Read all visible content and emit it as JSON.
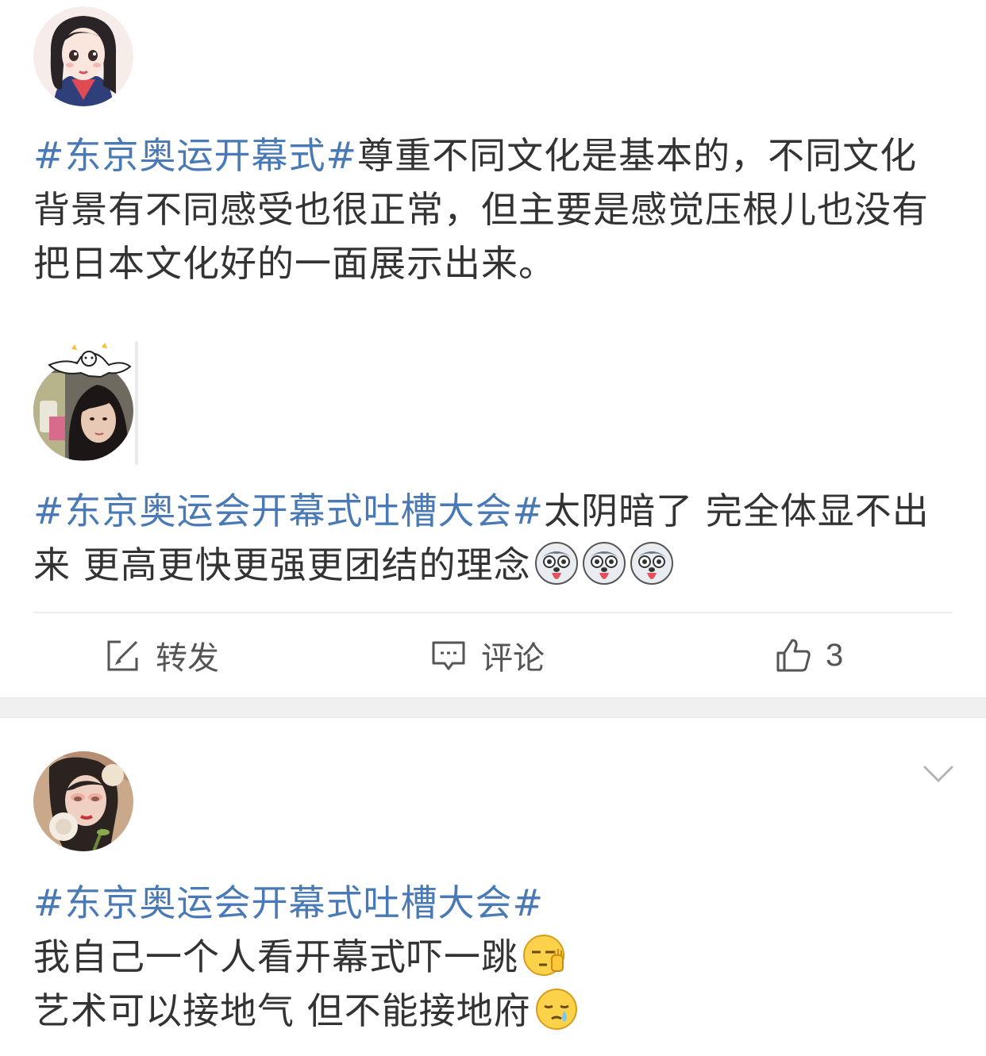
{
  "posts": [
    {
      "avatar_icon": "girl-cartoon-avatar",
      "segments": [
        {
          "text": "#东京奥运开幕式#",
          "tag": true
        },
        {
          "text": "尊重不同文化是基本的，不同文化背景有不同感受也很正常，但主要是感觉压根儿也没有把日本文化好的一面展示出来。",
          "tag": false
        }
      ]
    },
    {
      "avatar_icon": "girl-photo-avatar-with-bear-sticker",
      "segments": [
        {
          "text": "#东京奥运会开幕式吐槽大会#",
          "tag": true
        },
        {
          "text": "太阴暗了 完全体显不出来 更高更快更强更团结的理念",
          "tag": false
        }
      ],
      "emojis": [
        "husky-tongue-emoji",
        "husky-tongue-emoji",
        "husky-tongue-emoji"
      ]
    },
    {
      "avatar_icon": "woman-with-flowers-avatar",
      "segments": [
        {
          "text": "#东京奥运会开幕式吐槽大会#",
          "tag": true
        }
      ],
      "lines": [
        {
          "text": "我自己一个人看开幕式吓一跳",
          "emoji": "speechless-hand-emoji"
        },
        {
          "text": "艺术可以接地气 但不能接地府",
          "emoji": "sweat-face-emoji"
        }
      ]
    }
  ],
  "actions": {
    "repost_label": "转发",
    "comment_label": "评论",
    "like_count": "3"
  },
  "colors": {
    "tag_blue": "#4a7ab5",
    "text": "#333333",
    "gap_bg": "#f0f0f0"
  }
}
